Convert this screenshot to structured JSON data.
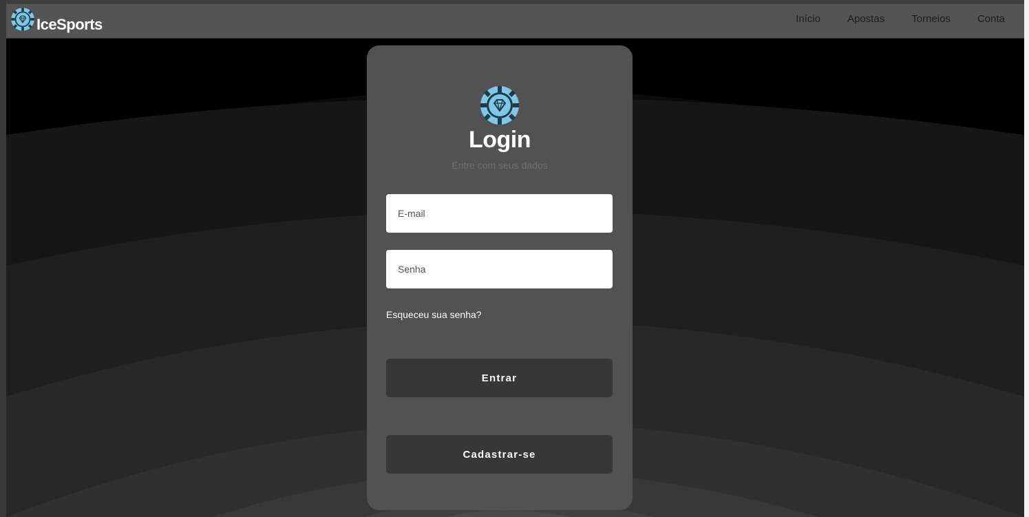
{
  "brand": {
    "name": "IceSports",
    "logo_icon": "diamond-chip-icon",
    "logo_color": "#7ec8e3"
  },
  "nav": {
    "items": [
      {
        "label": "Início"
      },
      {
        "label": "Apostas"
      },
      {
        "label": "Torneios"
      },
      {
        "label": "Conta"
      }
    ]
  },
  "login": {
    "title": "Login",
    "subtitle": "Entre com seus dados",
    "email_placeholder": "E-mail",
    "password_placeholder": "Senha",
    "forgot_label": "Esqueceu sua senha?",
    "submit_label": "Entrar",
    "signup_label": "Cadastrar-se"
  },
  "colors": {
    "accent": "#7ec8e3",
    "card": "#525252",
    "button": "#373737",
    "header": "#545454"
  }
}
